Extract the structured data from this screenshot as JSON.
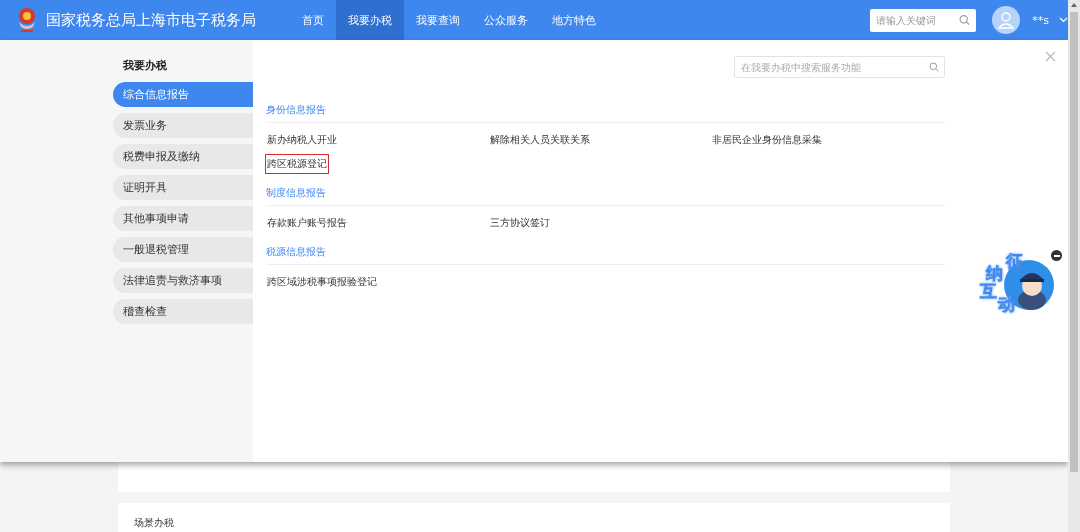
{
  "header": {
    "title": "国家税务总局上海市电子税务局",
    "nav": [
      {
        "label": "首页",
        "selected": false
      },
      {
        "label": "我要办税",
        "selected": true
      },
      {
        "label": "我要查询",
        "selected": false
      },
      {
        "label": "公众服务",
        "selected": false
      },
      {
        "label": "地方特色",
        "selected": false
      }
    ],
    "search": {
      "placeholder": "请输入关键词"
    },
    "user": "**s"
  },
  "menu": {
    "sidebar": {
      "title": "我要办税",
      "items": [
        {
          "label": "综合信息报告",
          "selected": true
        },
        {
          "label": "发票业务",
          "selected": false
        },
        {
          "label": "税费申报及缴纳",
          "selected": false
        },
        {
          "label": "证明开具",
          "selected": false
        },
        {
          "label": "其他事项申请",
          "selected": false
        },
        {
          "label": "一般退税管理",
          "selected": false
        },
        {
          "label": "法律追责与救济事项",
          "selected": false
        },
        {
          "label": "稽查检查",
          "selected": false
        }
      ]
    },
    "search": {
      "placeholder": "在我要办税中搜索服务功能"
    },
    "sections": [
      {
        "title": "身份信息报告",
        "items": [
          {
            "label": "新办纳税人开业",
            "highlighted": false
          },
          {
            "label": "解除相关人员关联关系",
            "highlighted": false
          },
          {
            "label": "非居民企业身份信息采集",
            "highlighted": false
          },
          {
            "label": "跨区税源登记",
            "highlighted": true
          }
        ]
      },
      {
        "title": "制度信息报告",
        "items": [
          {
            "label": "存款账户账号报告",
            "highlighted": false
          },
          {
            "label": "三方协议签订",
            "highlighted": false
          }
        ]
      },
      {
        "title": "税源信息报告",
        "items": [
          {
            "label": "跨区域涉税事项报验登记",
            "highlighted": false
          }
        ]
      }
    ]
  },
  "page": {
    "card": {
      "title": "场景办税"
    }
  },
  "widget": {
    "chars": [
      "征",
      "纳",
      "互",
      "动"
    ]
  }
}
